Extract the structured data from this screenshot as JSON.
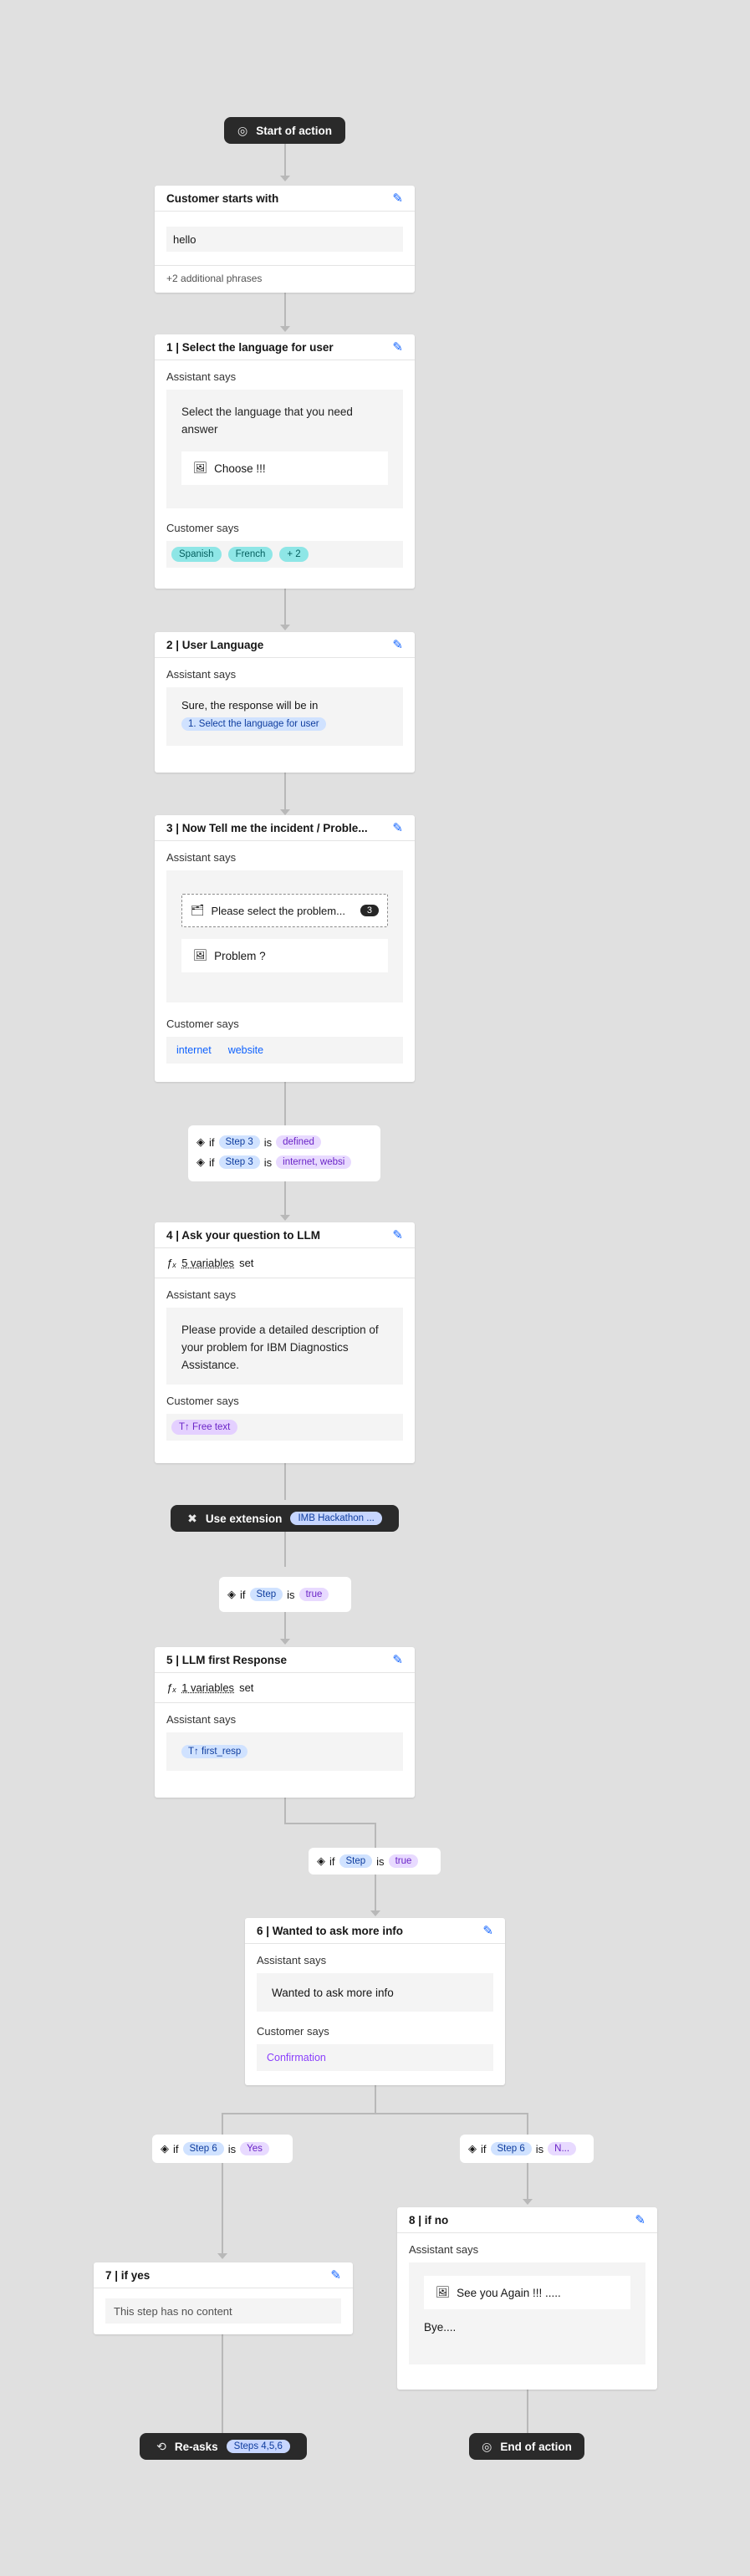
{
  "start_pill": {
    "label": "Start of action"
  },
  "end_pill": {
    "label": "End of action"
  },
  "reasks_pill": {
    "label": "Re-asks",
    "tag": "Steps 4,5,6"
  },
  "extension_pill": {
    "label": "Use extension",
    "tag": "IMB Hackathon ..."
  },
  "customer_start": {
    "title": "Customer starts with",
    "phrase": "hello",
    "more": "+2 additional phrases"
  },
  "labels": {
    "assistant_says": "Assistant says",
    "customer_says": "Customer says",
    "variables_set": "set",
    "if": "if",
    "is": "is"
  },
  "step1": {
    "title": "1 | Select the language for user",
    "message": "Select the language that you need answer",
    "choice": "Choose !!!",
    "options": [
      "Spanish",
      "French",
      "+ 2"
    ]
  },
  "step2": {
    "title": "2 | User Language",
    "message": "Sure, the response will be in",
    "ref": "1. Select the language for user"
  },
  "step3": {
    "title": "3 | Now Tell me the incident / Proble...",
    "option_label": "Please select the problem...",
    "option_count": "3",
    "choice": "Problem ?",
    "options": [
      "internet",
      "website"
    ]
  },
  "cond_step3": [
    {
      "var": "Step 3",
      "val": "defined"
    },
    {
      "var": "Step 3",
      "val": "internet, websi"
    }
  ],
  "step4": {
    "title": "4 | Ask your question to LLM",
    "vars": "5 variables",
    "message": "Please provide a detailed description of your problem for IBM Diagnostics Assistance.",
    "response": "Free text"
  },
  "cond_ext": {
    "var": "Step",
    "val": "true"
  },
  "step5": {
    "title": "5 | LLM first Response",
    "vars": "1 variables",
    "var_chip": "first_resp"
  },
  "cond_step5": {
    "var": "Step",
    "val": "true"
  },
  "step6": {
    "title": "6 | Wanted to ask more info",
    "message": "Wanted to ask more info",
    "response": "Confirmation"
  },
  "cond_yes": {
    "var": "Step 6",
    "val": "Yes"
  },
  "cond_no": {
    "var": "Step 6",
    "val": "N..."
  },
  "step7": {
    "title": "7 | if yes",
    "empty": "This step has no content"
  },
  "step8": {
    "title": "8 | if no",
    "choice": "See you Again !!! .....",
    "message": "Bye...."
  }
}
